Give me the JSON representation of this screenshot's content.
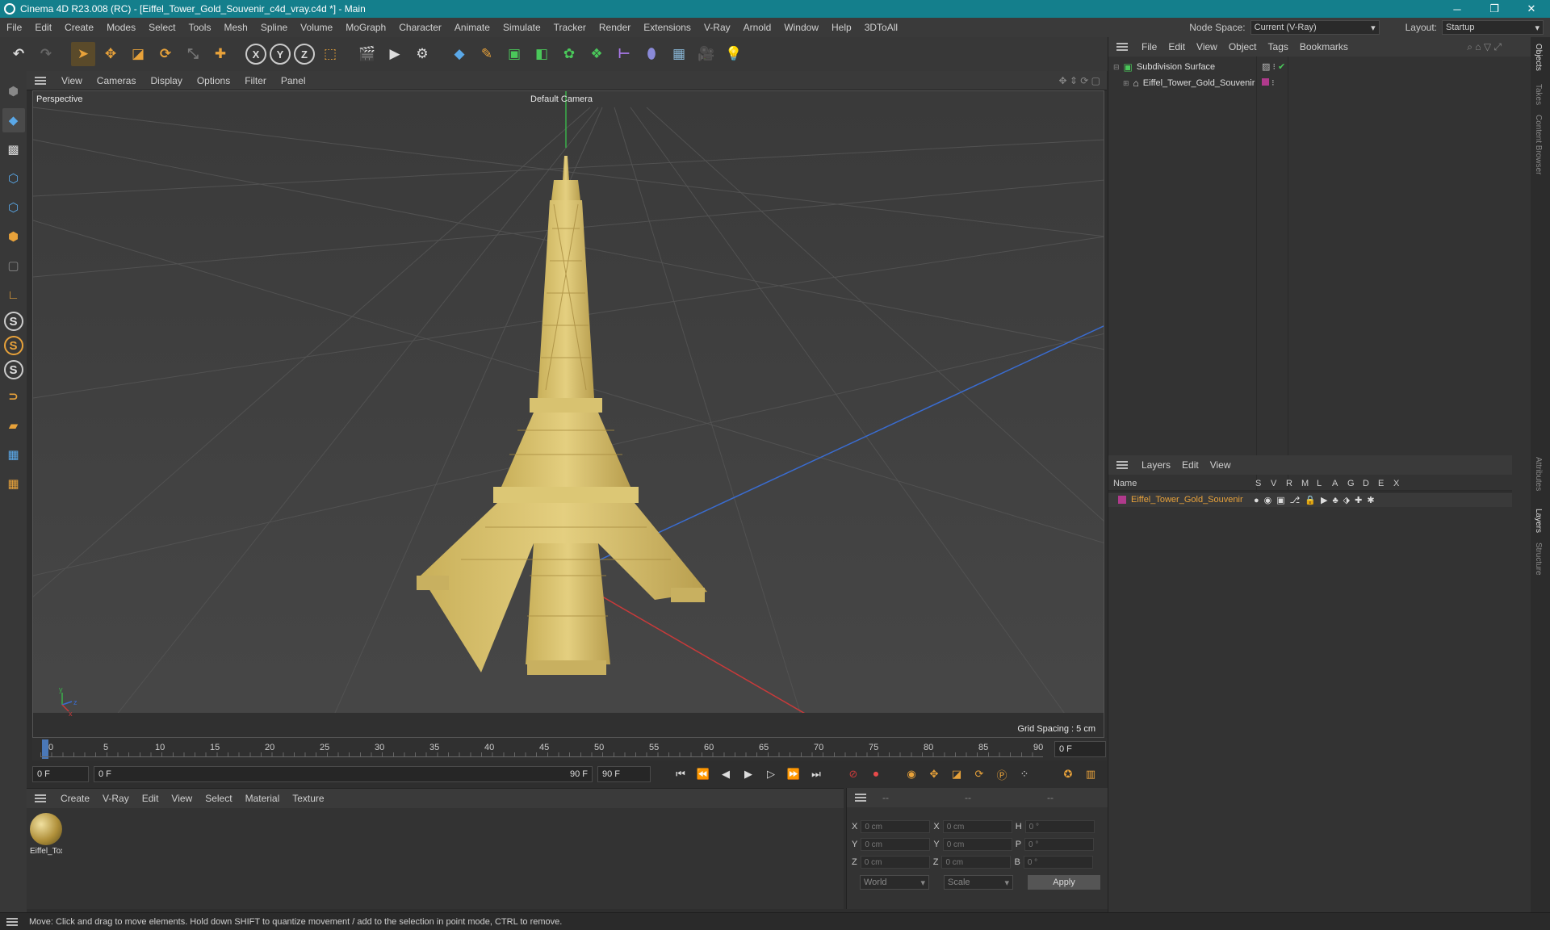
{
  "window": {
    "title": "Cinema 4D R23.008 (RC) - [Eiffel_Tower_Gold_Souvenir_c4d_vray.c4d *] - Main",
    "minimize": "─",
    "restore": "❐",
    "close": "✕"
  },
  "menubar": {
    "items": [
      "File",
      "Edit",
      "Create",
      "Modes",
      "Select",
      "Tools",
      "Mesh",
      "Spline",
      "Volume",
      "MoGraph",
      "Character",
      "Animate",
      "Simulate",
      "Tracker",
      "Render",
      "Extensions",
      "V-Ray",
      "Arnold",
      "Window",
      "Help",
      "3DToAll"
    ],
    "node_space_label": "Node Space:",
    "node_space_value": "Current (V-Ray)",
    "layout_label": "Layout:",
    "layout_value": "Startup"
  },
  "toolbar": {
    "x_axis": "X",
    "y_axis": "Y",
    "z_axis": "Z"
  },
  "viewport": {
    "menu": [
      "View",
      "Cameras",
      "Display",
      "Options",
      "Filter",
      "Panel"
    ],
    "projection": "Perspective",
    "camera": "Default Camera",
    "grid_spacing": "Grid Spacing : 5 cm",
    "axis_y": "y",
    "axis_z": "z",
    "axis_x": "x"
  },
  "timeline": {
    "ticks": [
      "0",
      "5",
      "10",
      "15",
      "20",
      "25",
      "30",
      "35",
      "40",
      "45",
      "50",
      "55",
      "60",
      "65",
      "70",
      "75",
      "80",
      "85",
      "90"
    ],
    "current_frame": "0 F",
    "start_frame": "0 F",
    "range_start": "0 F",
    "range_end": "90 F",
    "end_frame": "90 F"
  },
  "materials": {
    "menu": [
      "Create",
      "V-Ray",
      "Edit",
      "View",
      "Select",
      "Material",
      "Texture"
    ],
    "item_label": "Eiffel_Tox"
  },
  "coordinates": {
    "header": [
      "--",
      "--",
      "--"
    ],
    "rows": [
      {
        "a": "X",
        "av": "0 cm",
        "b": "X",
        "bv": "0 cm",
        "c": "H",
        "cv": "0 °"
      },
      {
        "a": "Y",
        "av": "0 cm",
        "b": "Y",
        "bv": "0 cm",
        "c": "P",
        "cv": "0 °"
      },
      {
        "a": "Z",
        "av": "0 cm",
        "b": "Z",
        "bv": "0 cm",
        "c": "B",
        "cv": "0 °"
      }
    ],
    "space": "World",
    "mode": "Scale",
    "apply": "Apply"
  },
  "objects": {
    "menu": [
      "File",
      "Edit",
      "View",
      "Object",
      "Tags",
      "Bookmarks"
    ],
    "items": [
      {
        "name": "Subdivision Surface"
      },
      {
        "name": "Eiffel_Tower_Gold_Souvenir"
      }
    ]
  },
  "layers": {
    "menu": [
      "Layers",
      "Edit",
      "View"
    ],
    "columns": [
      "Name",
      "S",
      "V",
      "R",
      "M",
      "L",
      "A",
      "G",
      "D",
      "E",
      "X"
    ],
    "rows": [
      {
        "name": "Eiffel_Tower_Gold_Souvenir",
        "color": "#b03a8c"
      }
    ]
  },
  "sidetabs": [
    "Objects",
    "Takes",
    "Content Browser",
    "Attributes",
    "Layers",
    "Structure"
  ],
  "status": {
    "text": "Move: Click and drag to move elements. Hold down SHIFT to quantize movement / add to the selection in point mode, CTRL to remove."
  },
  "colors": {
    "titlebar": "#147f8c",
    "accent_orange": "#e8a23a",
    "gold": "#d4bd6a",
    "axis_x": "#c83a3a",
    "axis_y": "#3ab04a",
    "axis_z": "#3a6cd0"
  },
  "icons": [
    "undo-icon",
    "redo-icon",
    "select-arrow-icon",
    "move-icon",
    "scale-icon",
    "rotate-icon",
    "cube-icon",
    "pen-icon",
    "play-icon",
    "camera-icon",
    "light-icon"
  ]
}
